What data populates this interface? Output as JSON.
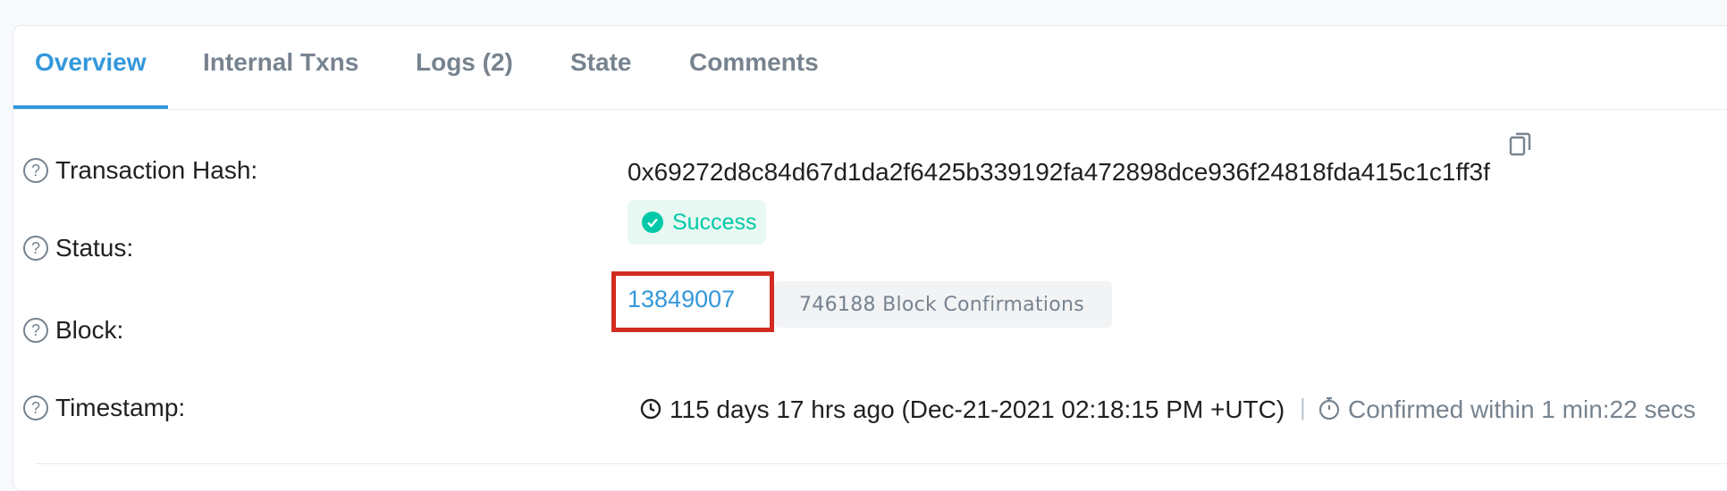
{
  "tabs": [
    {
      "label": "Overview",
      "active": true
    },
    {
      "label": "Internal Txns",
      "active": false
    },
    {
      "label": "Logs (2)",
      "active": false
    },
    {
      "label": "State",
      "active": false
    },
    {
      "label": "Comments",
      "active": false
    }
  ],
  "rows": {
    "hash": {
      "label": "Transaction Hash:",
      "value": "0x69272d8c84d67d1da2f6425b339192fa472898dce936f24818fda415c1c1ff3f"
    },
    "status": {
      "label": "Status:",
      "value": "Success"
    },
    "block": {
      "label": "Block:",
      "value": "13849007",
      "confirmations": "746188 Block Confirmations"
    },
    "timestamp": {
      "label": "Timestamp:",
      "value": "115 days 17 hrs ago (Dec-21-2021 02:18:15 PM +UTC)",
      "separator": "|",
      "confirmed": "Confirmed within 1 min:22 secs"
    }
  },
  "help_glyph": "?",
  "colors": {
    "accent": "#3498db",
    "success": "#00c9a7",
    "highlight": "#d22b21",
    "muted": "#77838f"
  },
  "icons": {
    "help": "question-circle-icon",
    "copy": "copy-icon",
    "status": "check-circle-icon",
    "clock": "clock-icon",
    "timer": "stopwatch-icon"
  }
}
